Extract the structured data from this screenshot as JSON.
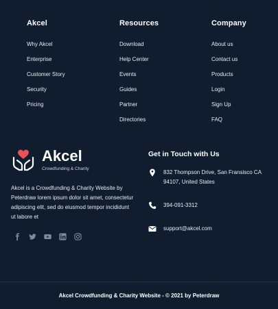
{
  "columns": [
    {
      "title": "Akcel",
      "items": [
        "Why Akcel",
        "Enterprise",
        "Customer Story",
        "Security",
        "Pricing"
      ]
    },
    {
      "title": "Resources",
      "items": [
        "Download",
        "Help Center",
        "Events",
        "Guides",
        "Partner",
        "Directories"
      ]
    },
    {
      "title": "Company",
      "items": [
        "About us",
        "Contact us",
        "Products",
        "Login",
        "Sign Up",
        "FAQ"
      ]
    }
  ],
  "brand": {
    "name": "Akcel",
    "tagline": "Crowdfunding & Charity"
  },
  "about": "Akcel is a Crowdfunding & Charity Website by Peterdraw lorem ipsum dolor sit amet, consectetur adipiscing elit, sed do eiusmod tempor incididunt ut labore et",
  "social": [
    "facebook-icon",
    "twitter-icon",
    "youtube-icon",
    "linkedin-icon",
    "instagram-icon"
  ],
  "contact": {
    "title": "Get in Touch with Us",
    "address": "832 Thompson Drive, San Fransisco CA 94107, United States",
    "phone": "394-091-3312",
    "email": "support@akcel.com"
  },
  "copyright": "Akcel Crowdfunding & Charity Website - © 2021 by Peterdraw",
  "colors": {
    "background": "#0f1d2f",
    "accent": "#e8505b",
    "muted_icon": "#7e8a9d"
  }
}
